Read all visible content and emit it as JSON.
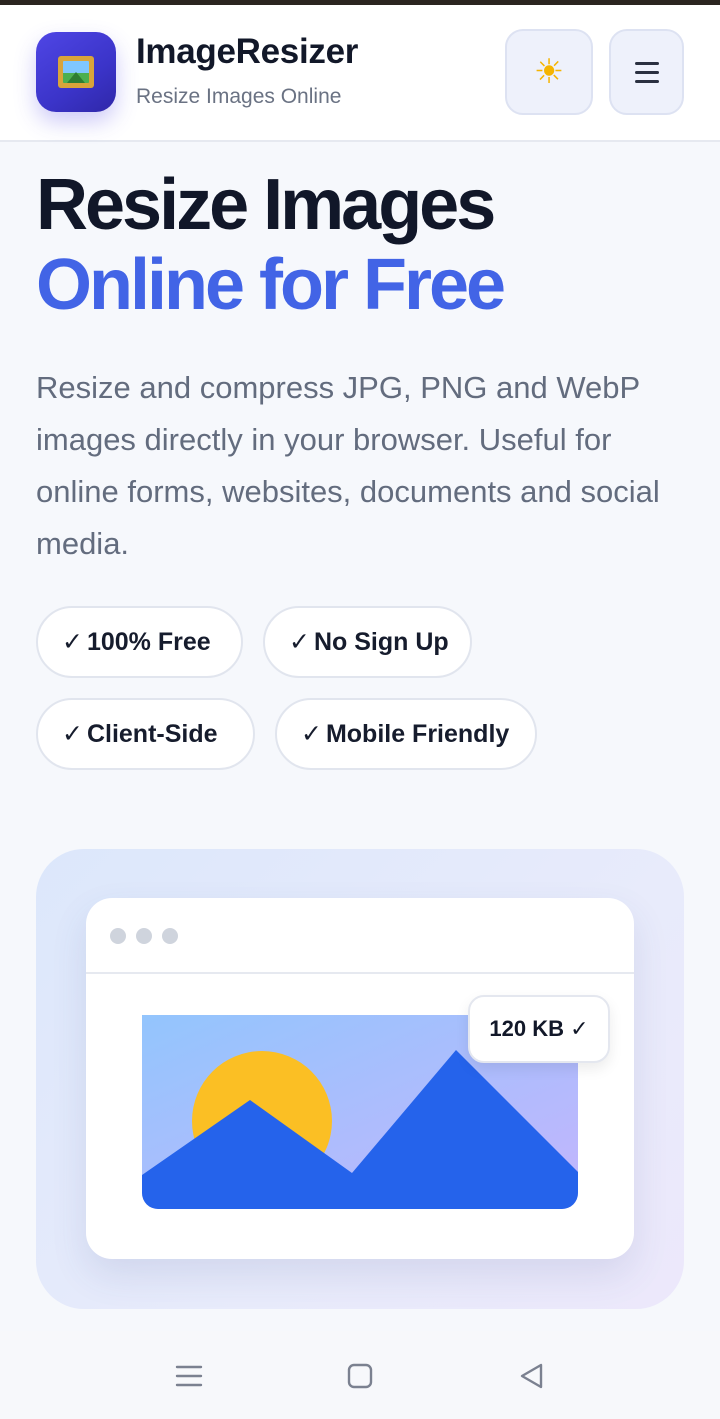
{
  "header": {
    "title": "ImageResizer",
    "subtitle": "Resize Images Online",
    "theme_icon": "sun-icon",
    "menu_icon": "hamburger-menu-icon",
    "logo_icon": "framed-picture-icon"
  },
  "hero": {
    "title_line1": "Resize Images",
    "title_line2": "Online for Free",
    "description": "Resize and compress JPG, PNG and WebP images directly in your browser. Useful for online forms, websites, documents and social media."
  },
  "features": [
    {
      "check": "✓",
      "label": "100% Free"
    },
    {
      "check": "✓",
      "label": "No Sign Up"
    },
    {
      "check": "✓",
      "label": "Client-Side"
    },
    {
      "check": "✓",
      "label": "Mobile Friendly"
    }
  ],
  "preview": {
    "size_badge": "120 KB ✓"
  },
  "colors": {
    "accent": "#4264e6",
    "heading": "#111729",
    "mountain": "#2563eb",
    "sun": "#fbbf24"
  },
  "system_nav": {
    "recent_icon": "recent-apps-icon",
    "home_icon": "home-icon",
    "back_icon": "back-icon"
  }
}
